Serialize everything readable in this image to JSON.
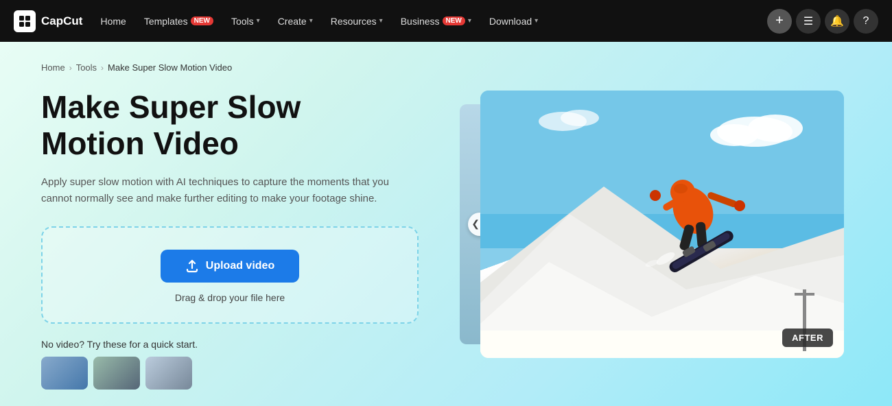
{
  "nav": {
    "logo_text": "CapCut",
    "items": [
      {
        "label": "Home",
        "has_badge": false,
        "has_chevron": false
      },
      {
        "label": "Templates",
        "has_badge": true,
        "badge_text": "New",
        "has_chevron": false
      },
      {
        "label": "Tools",
        "has_badge": false,
        "has_chevron": true
      },
      {
        "label": "Create",
        "has_badge": false,
        "has_chevron": true
      },
      {
        "label": "Resources",
        "has_badge": false,
        "has_chevron": true
      },
      {
        "label": "Business",
        "has_badge": true,
        "badge_text": "New",
        "has_chevron": true
      },
      {
        "label": "Download",
        "has_badge": false,
        "has_chevron": true
      }
    ],
    "plus_label": "+",
    "icons": [
      "☰",
      "🔔",
      "?"
    ]
  },
  "breadcrumb": {
    "home": "Home",
    "tools": "Tools",
    "current": "Make Super Slow Motion Video"
  },
  "hero": {
    "title": "Make Super Slow Motion Video",
    "description": "Apply super slow motion with AI techniques to capture the moments that you cannot normally see and make further editing to make your footage shine."
  },
  "upload": {
    "button_label": "Upload video",
    "drag_hint": "Drag & drop your file here"
  },
  "quick_start": {
    "label": "No video? Try these for a quick start."
  },
  "preview": {
    "after_badge": "AFTER",
    "arrow_left": "❮❯"
  }
}
